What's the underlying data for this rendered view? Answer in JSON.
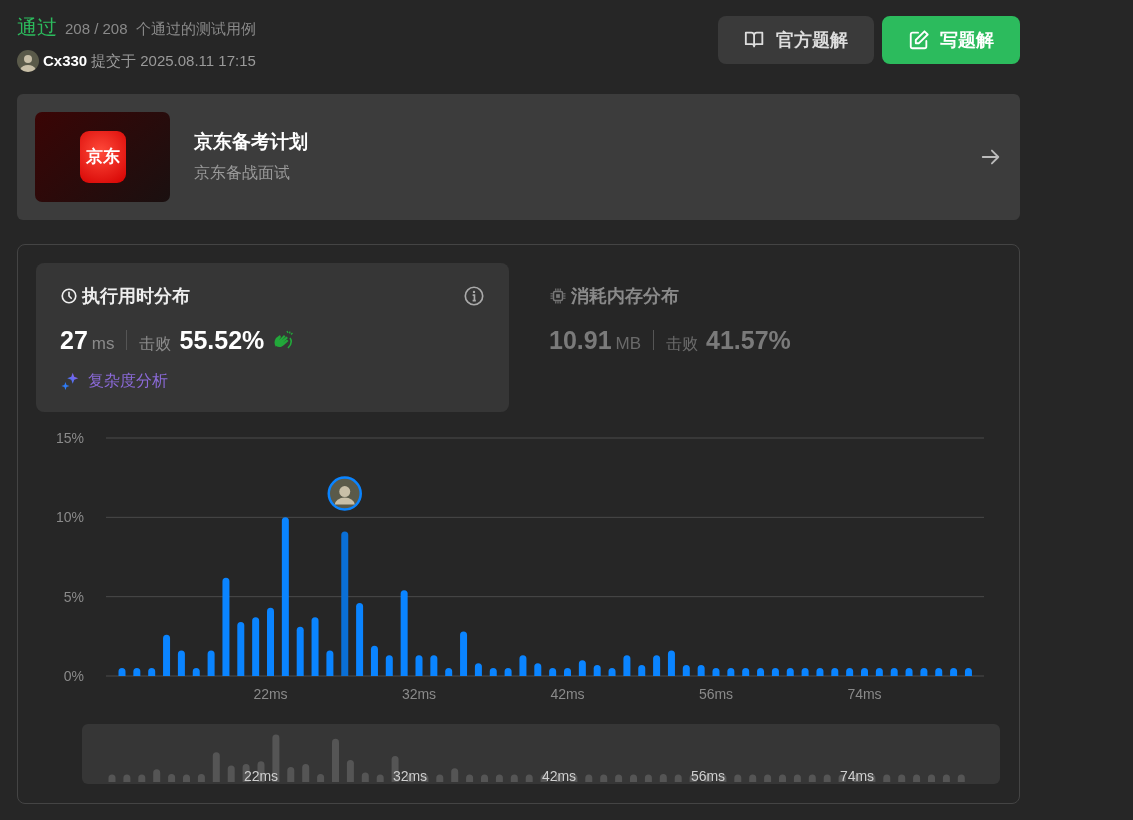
{
  "result": {
    "status": "通过",
    "cases": "208 / 208",
    "cases_label": "个通过的测试用例"
  },
  "submission": {
    "user": "Cx330",
    "submitted_label": "提交于",
    "time": "2025.08.11 17:15"
  },
  "buttons": [
    {
      "label": "官方题解",
      "kind": "secondary"
    },
    {
      "label": "写题解",
      "kind": "primary"
    }
  ],
  "promo": {
    "logo_text": "京东",
    "title": "京东备考计划",
    "subtitle": "京东备战面试"
  },
  "tabs": [
    {
      "title": "执行用时分布",
      "value": "27",
      "unit": "ms",
      "beats_label": "击败",
      "percent": "55.52%",
      "selected": true,
      "complexity_link": "复杂度分析"
    },
    {
      "title": "消耗内存分布",
      "value": "10.91",
      "unit": "MB",
      "beats_label": "击败",
      "percent": "41.57%",
      "selected": false
    }
  ],
  "chart_data": {
    "type": "bar",
    "categories": [
      null,
      null,
      null,
      null,
      null,
      null,
      null,
      null,
      null,
      null,
      "22ms",
      null,
      null,
      null,
      null,
      null,
      null,
      null,
      null,
      null,
      "32ms",
      null,
      null,
      null,
      null,
      null,
      null,
      null,
      null,
      null,
      "42ms",
      null,
      null,
      null,
      null,
      null,
      null,
      null,
      null,
      null,
      "56ms",
      null,
      null,
      null,
      null,
      null,
      null,
      null,
      null,
      null,
      "74ms",
      null,
      null,
      null,
      null,
      null,
      null,
      null
    ],
    "values": [
      0.5,
      0.5,
      0.5,
      2.6,
      1.6,
      0.5,
      1.6,
      6.2,
      3.4,
      3.7,
      4.3,
      10.0,
      3.1,
      3.7,
      1.6,
      9.1,
      4.6,
      1.9,
      1.3,
      5.4,
      1.3,
      1.3,
      0.5,
      2.8,
      0.8,
      0.5,
      0.5,
      1.3,
      0.8,
      0.5,
      0.5,
      1.0,
      0.7,
      0.5,
      1.3,
      0.7,
      1.3,
      1.6,
      0.7,
      0.7,
      0.5,
      0.5,
      0.5,
      0.5,
      0.5,
      0.5,
      0.5,
      0.5,
      0.5,
      0.5,
      0.5,
      0.5,
      0.5,
      0.5,
      0.5,
      0.5,
      0.5,
      0.5
    ],
    "ylim": [
      0,
      15
    ],
    "yticks": [
      {
        "value": 0,
        "label": "0%"
      },
      {
        "value": 5,
        "label": "5%"
      },
      {
        "value": 10,
        "label": "10%"
      },
      {
        "value": 15,
        "label": "15%"
      }
    ]
  },
  "bars": [
    {
      "selected": false
    },
    {
      "selected": false
    },
    {
      "selected": false
    },
    {
      "selected": false
    },
    {
      "selected": false
    },
    {
      "selected": false
    },
    {
      "selected": false
    },
    {
      "selected": false
    },
    {
      "selected": false
    },
    {
      "selected": false
    },
    {
      "selected": false
    },
    {
      "selected": false
    },
    {
      "selected": false
    },
    {
      "selected": false
    },
    {
      "selected": false
    },
    {
      "selected": true
    },
    {
      "selected": false
    },
    {
      "selected": false
    },
    {
      "selected": false
    },
    {
      "selected": false
    },
    {
      "selected": false
    },
    {
      "selected": false
    },
    {
      "selected": false
    },
    {
      "selected": false
    },
    {
      "selected": false
    },
    {
      "selected": false
    },
    {
      "selected": false
    },
    {
      "selected": false
    },
    {
      "selected": false
    },
    {
      "selected": false
    },
    {
      "selected": false
    },
    {
      "selected": false
    },
    {
      "selected": false
    },
    {
      "selected": false
    },
    {
      "selected": false
    },
    {
      "selected": false
    },
    {
      "selected": false
    },
    {
      "selected": false
    },
    {
      "selected": false
    },
    {
      "selected": false
    },
    {
      "selected": false
    },
    {
      "selected": false
    },
    {
      "selected": false
    },
    {
      "selected": false
    },
    {
      "selected": false
    },
    {
      "selected": false
    },
    {
      "selected": false
    },
    {
      "selected": false
    },
    {
      "selected": false
    },
    {
      "selected": false
    },
    {
      "selected": false
    },
    {
      "selected": false
    },
    {
      "selected": false
    },
    {
      "selected": false
    },
    {
      "selected": false
    },
    {
      "selected": false
    },
    {
      "selected": false
    },
    {
      "selected": false
    }
  ],
  "overview": {
    "labels": [
      "22ms",
      "32ms",
      "42ms",
      "56ms",
      "74ms"
    ]
  }
}
